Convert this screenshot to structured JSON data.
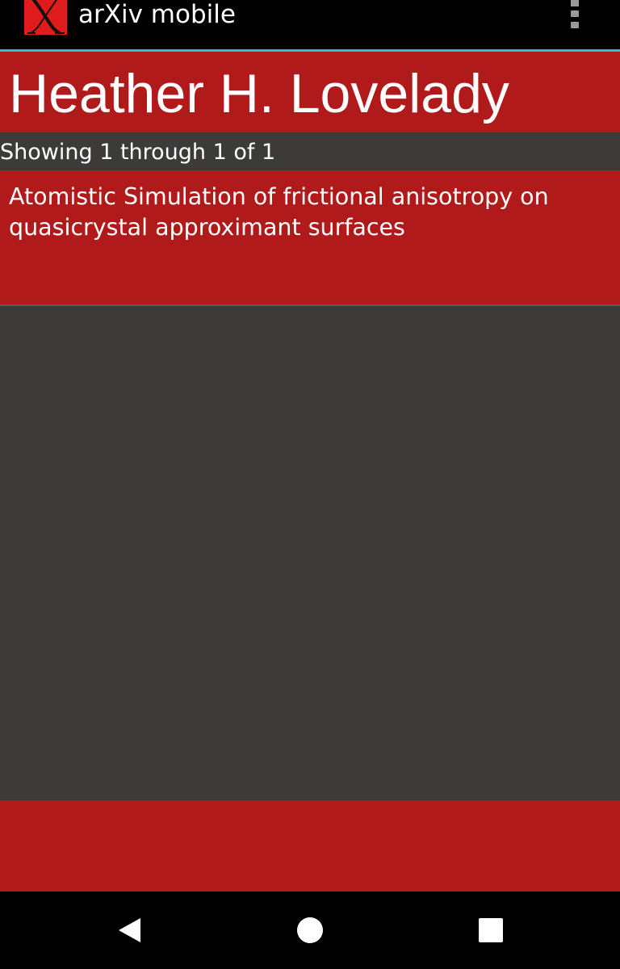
{
  "action_bar": {
    "title": "arXiv mobile",
    "icon": "arxiv-x-logo",
    "overflow_icon": "more-vert-icon"
  },
  "header": {
    "author_name": "Heather H. Lovelady"
  },
  "results": {
    "count_text": "Showing 1 through 1 of 1",
    "items": [
      {
        "title": "Atomistic Simulation of frictional anisotropy on quasicrystal approximant surfaces"
      }
    ]
  },
  "nav_bar": {
    "back_icon": "back-triangle-icon",
    "home_icon": "home-circle-icon",
    "recents_icon": "recents-square-icon"
  },
  "colors": {
    "accent_red": "#b11a1a",
    "background": "#3c3b3a",
    "action_bar": "#000000",
    "divider_blue": "#33b5e5"
  }
}
